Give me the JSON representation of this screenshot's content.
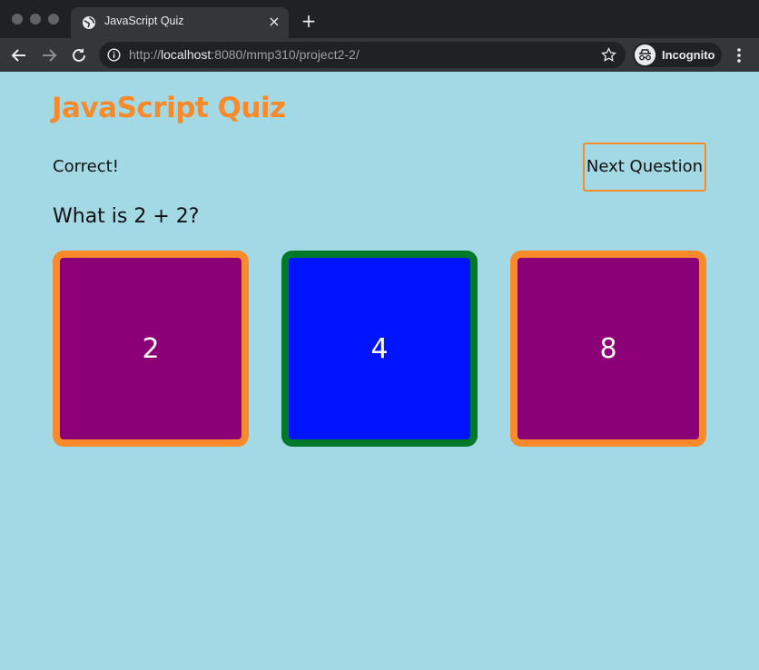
{
  "browser": {
    "tab_title": "JavaScript Quiz",
    "url_scheme": "http://",
    "url_host": "localhost",
    "url_path": ":8080/mmp310/project2-2/",
    "profile_label": "Incognito",
    "icons": {
      "back": "back-arrow-icon",
      "forward": "forward-arrow-icon",
      "reload": "reload-icon",
      "info": "info-icon",
      "bookmark": "star-icon",
      "incognito": "incognito-icon",
      "menu": "kebab-menu-icon",
      "favicon": "globe-icon",
      "close_tab": "close-icon",
      "new_tab": "plus-icon"
    }
  },
  "quiz": {
    "title": "JavaScript Quiz",
    "feedback": "Correct!",
    "next_button_label": "Next Question",
    "question": "What is 2 + 2?",
    "answers": [
      {
        "label": "2",
        "state": "wrong",
        "fill": "#8b0077",
        "border": "#f78b2c"
      },
      {
        "label": "4",
        "state": "correct",
        "fill": "#0014ff",
        "border": "#007a2a"
      },
      {
        "label": "8",
        "state": "wrong",
        "fill": "#8b0077",
        "border": "#f78b2c"
      }
    ]
  },
  "colors": {
    "accent": "#f78b2c",
    "page_background": "#a3d8e5",
    "correct_border": "#007a2a",
    "correct_fill": "#0014ff",
    "wrong_fill": "#8b0077"
  }
}
